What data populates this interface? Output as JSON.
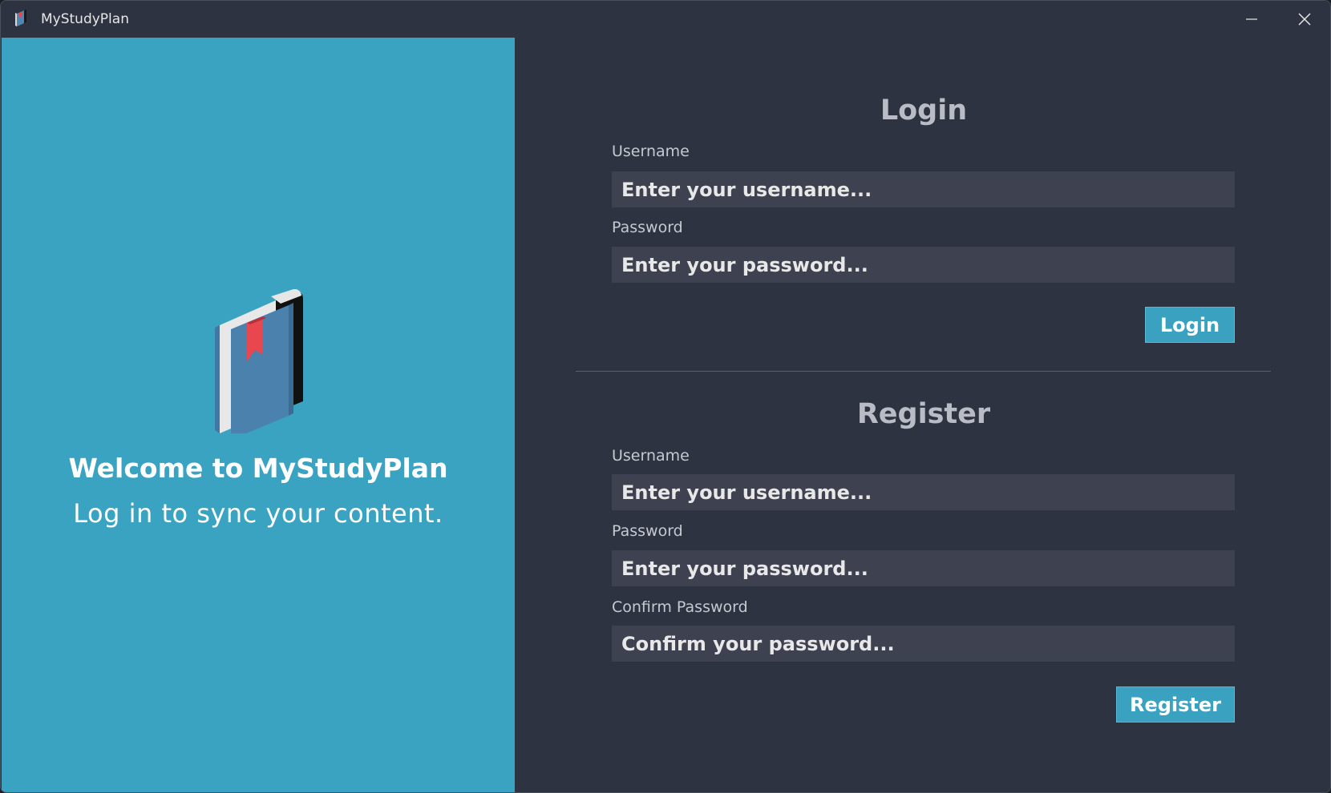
{
  "window": {
    "title": "MyStudyPlan",
    "icon": "book-icon",
    "minimize_icon": "minimize-icon",
    "close_icon": "close-icon"
  },
  "welcome": {
    "icon": "book-with-bookmark-icon",
    "title": "Welcome to MyStudyPlan",
    "subtitle": "Log in to sync your content."
  },
  "login": {
    "title": "Login",
    "username_label": "Username",
    "username_placeholder": "Enter your username...",
    "username_value": "",
    "password_label": "Password",
    "password_placeholder": "Enter your password...",
    "password_value": "",
    "button_label": "Login"
  },
  "register": {
    "title": "Register",
    "username_label": "Username",
    "username_placeholder": "Enter your username...",
    "username_value": "",
    "password_label": "Password",
    "password_placeholder": "Enter your password...",
    "password_value": "",
    "confirm_label": "Confirm Password",
    "confirm_placeholder": "Confirm your password...",
    "confirm_value": "",
    "button_label": "Register"
  },
  "colors": {
    "accent": "#3ba3c2",
    "panel_bg": "#2e3341",
    "input_bg": "#3e4250",
    "bookmark": "#e8474f"
  }
}
